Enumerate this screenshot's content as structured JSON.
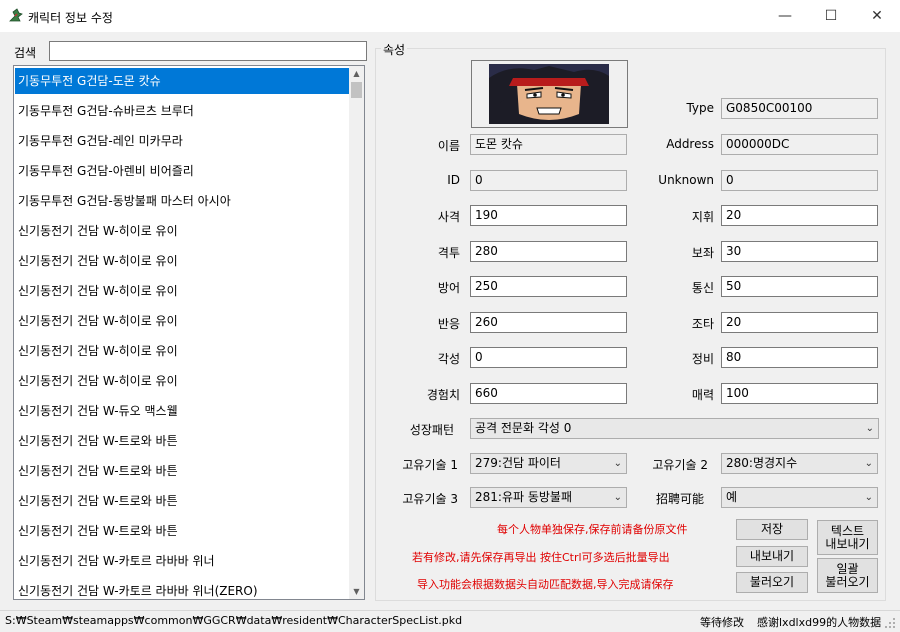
{
  "window": {
    "title": "캐릭터 정보 수정",
    "min": "—",
    "max": "☐",
    "close": "✕"
  },
  "search": {
    "label": "검색",
    "value": ""
  },
  "list": [
    "기동무투전 G건담-도몬 캇슈",
    "기동무투전 G건담-슈바르츠 브루더",
    "기동무투전 G건담-레인 미카무라",
    "기동무투전 G건담-아렌비 비어즐리",
    "기동무투전 G건담-동방불패 마스터 아시아",
    "신기동전기 건담 W-히이로 유이",
    "신기동전기 건담 W-히이로 유이",
    "신기동전기 건담 W-히이로 유이",
    "신기동전기 건담 W-히이로 유이",
    "신기동전기 건담 W-히이로 유이",
    "신기동전기 건담 W-히이로 유이",
    "신기동전기 건담 W-듀오 맥스웰",
    "신기동전기 건담 W-트로와 바튼",
    "신기동전기 건담 W-트로와 바튼",
    "신기동전기 건담 W-트로와 바튼",
    "신기동전기 건담 W-트로와 바튼",
    "신기동전기 건담 W-카토르 라바바 위너",
    "신기동전기 건담 W-카토르 라바바 위너(ZERO)"
  ],
  "group": {
    "title": "속성"
  },
  "fields": {
    "type": {
      "label": "Type",
      "value": "G0850C00100"
    },
    "name": {
      "label": "이름",
      "value": "도몬 캇슈"
    },
    "address": {
      "label": "Address",
      "value": "000000DC"
    },
    "id": {
      "label": "ID",
      "value": "0"
    },
    "unknown": {
      "label": "Unknown",
      "value": "0"
    },
    "shooting": {
      "label": "사격",
      "value": "190"
    },
    "command": {
      "label": "지휘",
      "value": "20"
    },
    "melee": {
      "label": "격투",
      "value": "280"
    },
    "support": {
      "label": "보좌",
      "value": "30"
    },
    "defense": {
      "label": "방어",
      "value": "250"
    },
    "comm": {
      "label": "통신",
      "value": "50"
    },
    "reaction": {
      "label": "반응",
      "value": "260"
    },
    "piloting": {
      "label": "조타",
      "value": "20"
    },
    "awakening": {
      "label": "각성",
      "value": "0"
    },
    "maintenance": {
      "label": "정비",
      "value": "80"
    },
    "experience": {
      "label": "경험치",
      "value": "660"
    },
    "charm": {
      "label": "매력",
      "value": "100"
    }
  },
  "growth": {
    "label": "성장패턴",
    "value": "공격 전문화 각성 0"
  },
  "skill1": {
    "label": "고유기술 1",
    "value": "279:건담 파이터"
  },
  "skill2": {
    "label": "고유기술 2",
    "value": "280:명경지수"
  },
  "skill3": {
    "label": "고유기술 3",
    "value": "281:유파 동방불패"
  },
  "recruit": {
    "label": "招聘可能",
    "value": "예"
  },
  "notes": [
    "每个人物单独保存,保存前请备份原文件",
    "若有修改,请先保存再导出 按住Ctrl可多选后批量导出",
    "导入功能会根据数据头自动匹配数据,导入完成请保存"
  ],
  "buttons": {
    "save": "저장",
    "export": "내보내기",
    "import": "불러오기",
    "text_export": "텍스트\n내보내기",
    "bulk_import": "일괄\n불러오기"
  },
  "status": {
    "path": "S:₩Steam₩steamapps₩common₩GGCR₩data₩resident₩CharacterSpecList.pkd",
    "state": "等待修改",
    "credit": "感谢lxdlxd99的人物数据"
  }
}
